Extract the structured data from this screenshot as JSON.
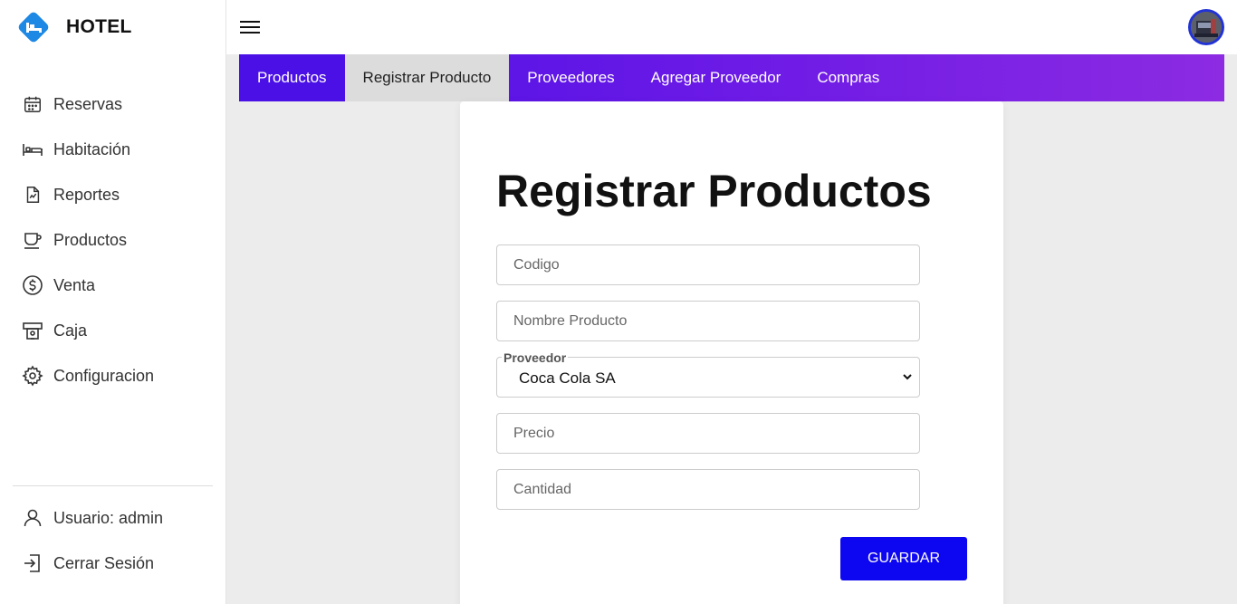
{
  "brand": {
    "title": "HOTEL",
    "logo_icon": "hotel-bed-icon",
    "logo_color": "#1e88e5"
  },
  "sidebar": {
    "items": [
      {
        "label": "Reservas",
        "icon": "calendar-icon"
      },
      {
        "label": "Habitación",
        "icon": "bed-icon"
      },
      {
        "label": "Reportes",
        "icon": "report-icon"
      },
      {
        "label": "Productos",
        "icon": "cup-icon"
      },
      {
        "label": "Venta",
        "icon": "dollar-coin-icon"
      },
      {
        "label": "Caja",
        "icon": "cash-register-icon"
      },
      {
        "label": "Configuracion",
        "icon": "gear-icon"
      }
    ],
    "bottom": [
      {
        "label": "Usuario: admin",
        "icon": "user-icon"
      },
      {
        "label": "Cerrar Sesión",
        "icon": "logout-icon"
      }
    ]
  },
  "tabs": [
    {
      "label": "Productos"
    },
    {
      "label": "Registrar Producto",
      "active": true
    },
    {
      "label": "Proveedores"
    },
    {
      "label": "Agregar Proveedor"
    },
    {
      "label": "Compras"
    }
  ],
  "form": {
    "title": "Registrar Productos",
    "codigo_placeholder": "Codigo",
    "nombre_placeholder": "Nombre Producto",
    "proveedor_label": "Proveedor",
    "proveedor_value": "Coca Cola SA",
    "precio_placeholder": "Precio",
    "cantidad_placeholder": "Cantidad",
    "save_label": "GUARDAR"
  },
  "colors": {
    "accent": "#0d06f0",
    "tab_gradient_start": "#4a10e6",
    "tab_gradient_end": "#8c2be2",
    "active_tab": "#dcdcdc"
  }
}
